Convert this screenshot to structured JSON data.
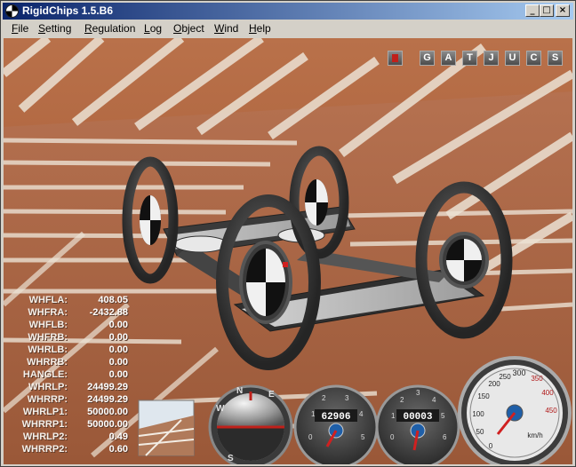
{
  "window": {
    "title": "RigidChips 1.5.B6"
  },
  "title_buttons": {
    "minimize": "_",
    "maximize": "□",
    "close": "×"
  },
  "menu": [
    {
      "label": "File",
      "mnemonic": "F"
    },
    {
      "label": "Setting",
      "mnemonic": "S"
    },
    {
      "label": "Regulation",
      "mnemonic": "R"
    },
    {
      "label": "Log",
      "mnemonic": "L"
    },
    {
      "label": "Object",
      "mnemonic": "O"
    },
    {
      "label": "Wind",
      "mnemonic": "W"
    },
    {
      "label": "Help",
      "mnemonic": "H"
    }
  ],
  "hud_buttons": [
    "",
    "G",
    "A",
    "T",
    "J",
    "U",
    "C",
    "S"
  ],
  "telemetry": [
    {
      "label": "WHFLA:",
      "value": "408.05"
    },
    {
      "label": "WHFRA:",
      "value": "-2432.88"
    },
    {
      "label": "WHFLB:",
      "value": "0.00"
    },
    {
      "label": "WHFRB:",
      "value": "0.00"
    },
    {
      "label": "WHRLB:",
      "value": "0.00"
    },
    {
      "label": "WHRRB:",
      "value": "0.00"
    },
    {
      "label": "HANGLE:",
      "value": "0.00"
    },
    {
      "label": "WHRLP:",
      "value": "24499.29"
    },
    {
      "label": "WHRRP:",
      "value": "24499.29"
    },
    {
      "label": "WHRLP1:",
      "value": "50000.00"
    },
    {
      "label": "WHRRP1:",
      "value": "50000.00"
    },
    {
      "label": "WHRLP2:",
      "value": "0.49"
    },
    {
      "label": "WHRRP2:",
      "value": "0.60"
    }
  ],
  "gauges": {
    "compass": {
      "letters": [
        "W",
        "N",
        "E",
        "S"
      ]
    },
    "tach1": {
      "readout": "62906",
      "ticks": [
        "0",
        "1",
        "2",
        "3",
        "4",
        "5"
      ]
    },
    "tach2": {
      "readout": "00003",
      "ticks": [
        "0",
        "1",
        "2",
        "3",
        "4",
        "5",
        "6"
      ]
    },
    "speedometer": {
      "ticks": [
        "0",
        "50",
        "100",
        "150",
        "200",
        "250",
        "300",
        "350",
        "400",
        "450"
      ],
      "unit": "km/h"
    }
  },
  "colors": {
    "titlebar_start": "#0a246a",
    "titlebar_end": "#a6caf0",
    "floor": "#b06a44",
    "stripe": "#ece2d4",
    "hud_active": "#c0201a"
  }
}
